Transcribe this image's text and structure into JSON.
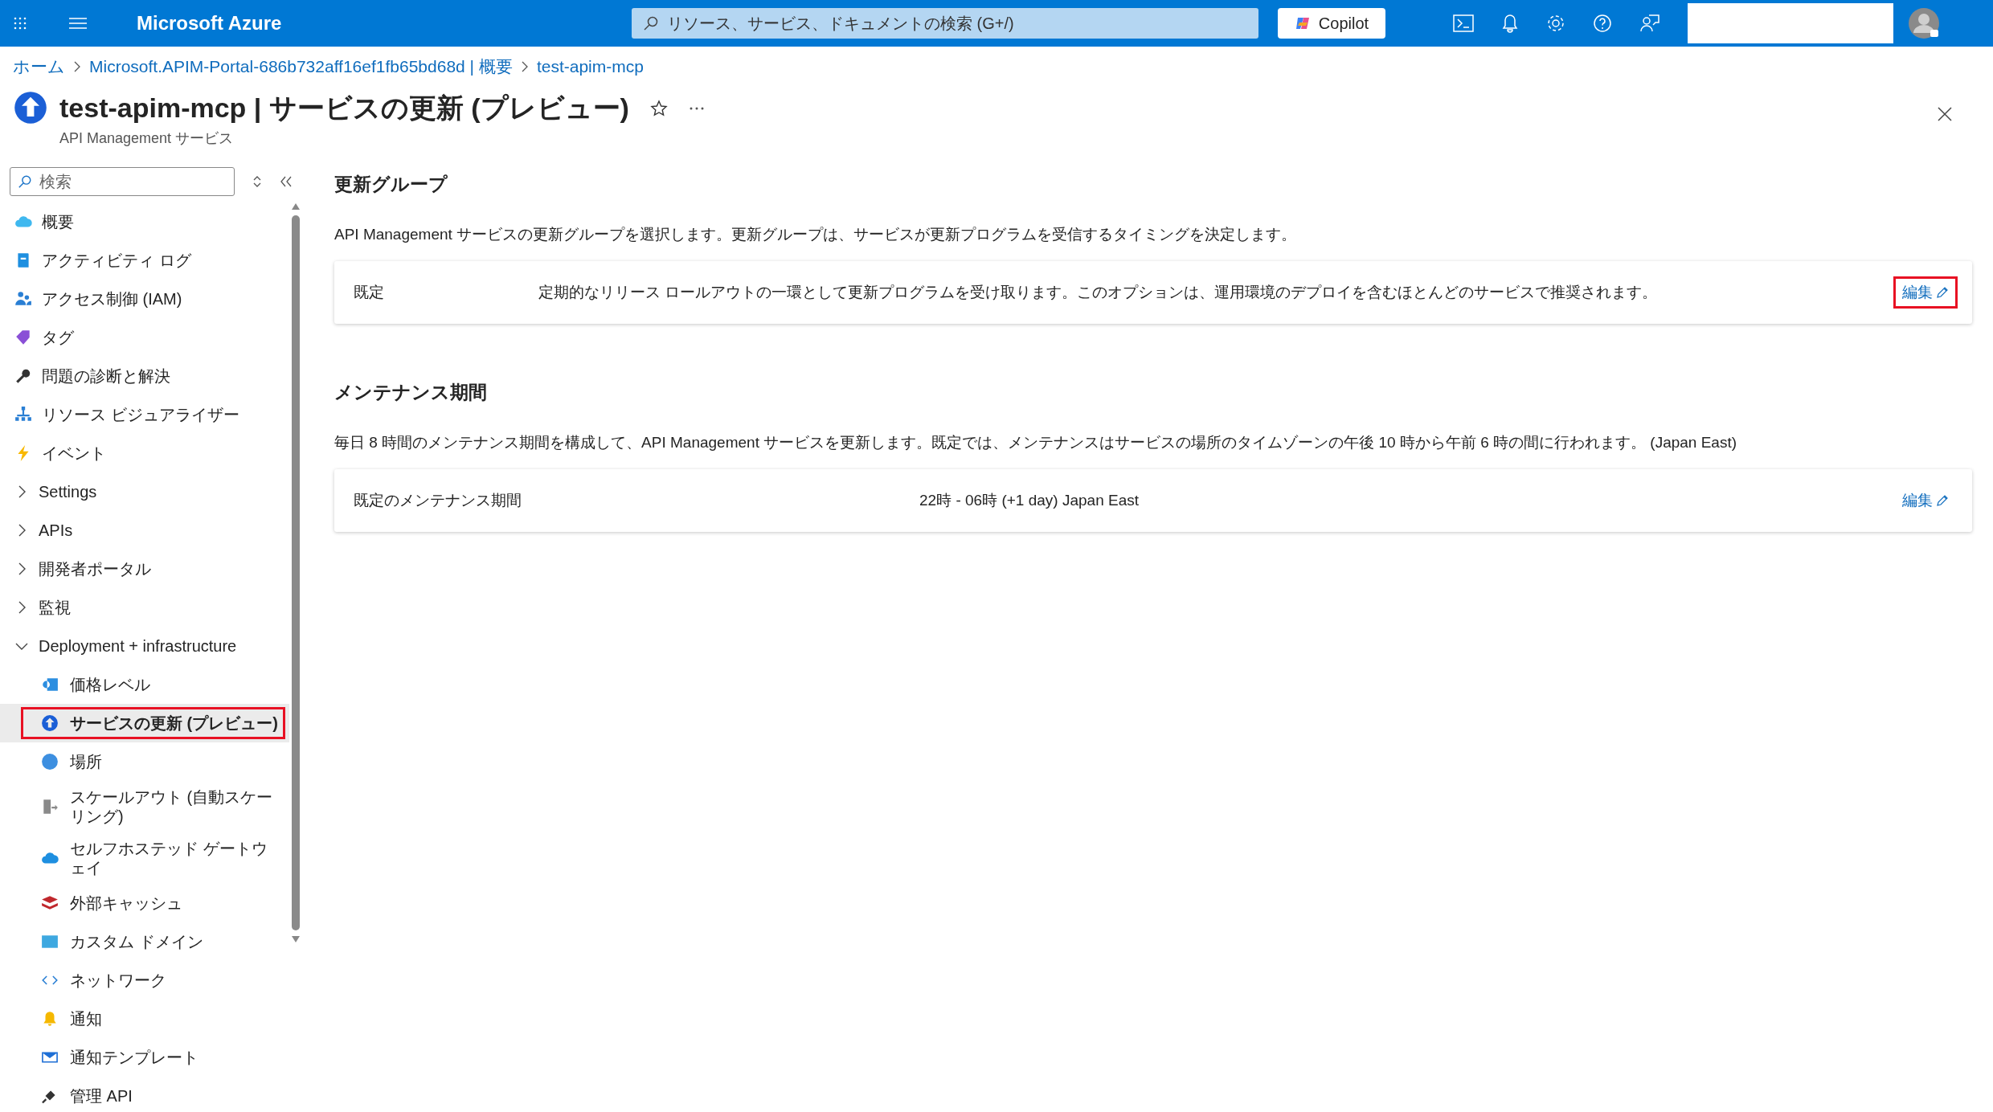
{
  "topbar": {
    "brand": "Microsoft Azure",
    "search": {
      "placeholder": "リソース、サービス、ドキュメントの検索 (G+/)"
    },
    "copilot": "Copilot"
  },
  "breadcrumb": [
    "ホーム",
    "Microsoft.APIM-Portal-686b732aff16ef1fb65bd68d | 概要",
    "test-apim-mcp"
  ],
  "page": {
    "title": "test-apim-mcp | サービスの更新 (プレビュー)",
    "subtitle": "API Management サービス"
  },
  "sidebar": {
    "search": {
      "placeholder": "検索"
    },
    "items": [
      {
        "label": "概要",
        "kind": "link",
        "selected": false
      },
      {
        "label": "アクティビティ ログ",
        "kind": "link",
        "selected": false
      },
      {
        "label": "アクセス制御 (IAM)",
        "kind": "link",
        "selected": false
      },
      {
        "label": "タグ",
        "kind": "link",
        "selected": false
      },
      {
        "label": "問題の診断と解決",
        "kind": "link",
        "selected": false
      },
      {
        "label": "リソース ビジュアライザー",
        "kind": "link",
        "selected": false
      },
      {
        "label": "イベント",
        "kind": "link",
        "selected": false
      },
      {
        "label": "Settings",
        "kind": "group",
        "expanded": false
      },
      {
        "label": "APIs",
        "kind": "group",
        "expanded": false
      },
      {
        "label": "開発者ポータル",
        "kind": "group",
        "expanded": false
      },
      {
        "label": "監視",
        "kind": "group",
        "expanded": false
      },
      {
        "label": "Deployment + infrastructure",
        "kind": "group",
        "expanded": true,
        "children": [
          {
            "label": "価格レベル",
            "selected": false,
            "highlighted": false
          },
          {
            "label": "サービスの更新 (プレビュー)",
            "selected": true,
            "highlighted": true
          },
          {
            "label": "場所",
            "selected": false,
            "highlighted": false
          },
          {
            "label": "スケールアウト (自動スケーリング)",
            "selected": false,
            "highlighted": false
          },
          {
            "label": "セルフホステッド ゲートウェイ",
            "selected": false,
            "highlighted": false
          },
          {
            "label": "外部キャッシュ",
            "selected": false,
            "highlighted": false
          },
          {
            "label": "カスタム ドメイン",
            "selected": false,
            "highlighted": false
          },
          {
            "label": "ネットワーク",
            "selected": false,
            "highlighted": false
          },
          {
            "label": "通知",
            "selected": false,
            "highlighted": false
          },
          {
            "label": "通知テンプレート",
            "selected": false,
            "highlighted": false
          },
          {
            "label": "管理 API",
            "selected": false,
            "highlighted": false
          }
        ]
      }
    ]
  },
  "sections": [
    {
      "heading": "更新グループ",
      "description": "API Management サービスの更新グループを選択します。更新グループは、サービスが更新プログラムを受信するタイミングを決定します。",
      "row": {
        "label": "既定",
        "value": "定期的なリリース ロールアウトの一環として更新プログラムを受け取ります。このオプションは、運用環境のデプロイを含むほとんどのサービスで推奨されます。",
        "edit": "編集",
        "highlighted": true
      }
    },
    {
      "heading": "メンテナンス期間",
      "description": "毎日 8 時間のメンテナンス期間を構成して、API Management サービスを更新します。既定では、メンテナンスはサービスの場所のタイムゾーンの午後 10 時から午前 6 時の間に行われます。 (Japan East)",
      "row": {
        "label": "既定のメンテナンス期間",
        "value": "22時 - 06時 (+1 day) Japan East",
        "edit": "編集",
        "highlighted": false
      }
    }
  ]
}
